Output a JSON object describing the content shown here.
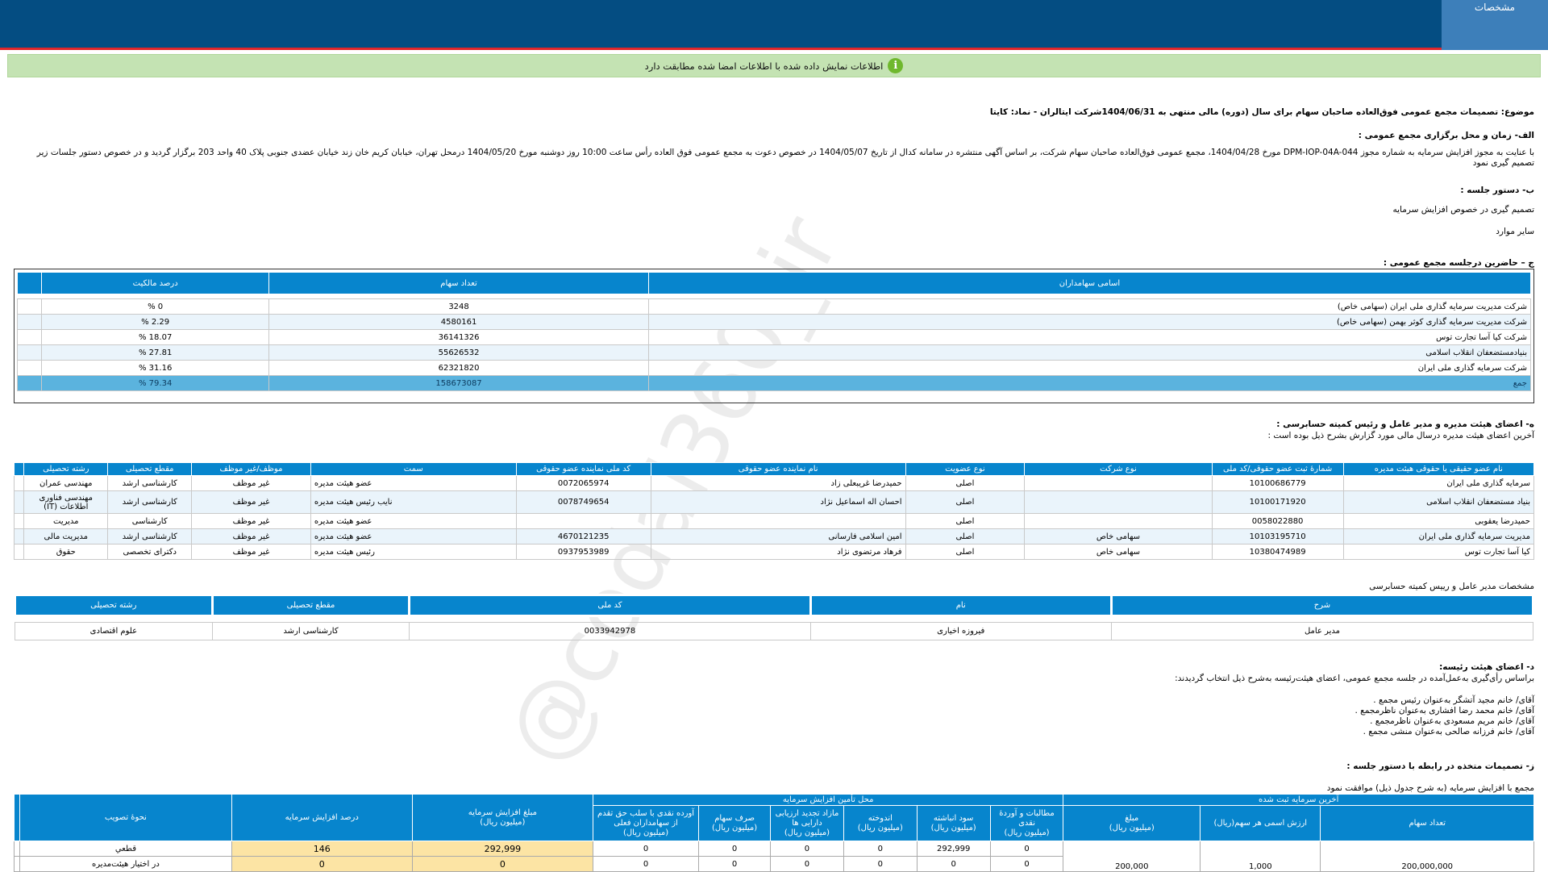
{
  "header": {
    "tab_label": "مشخصات"
  },
  "notice": {
    "text": "اطلاعات نمایش داده شده با اطلاعات امضا شده مطابقت دارد",
    "icon": "i"
  },
  "subject": "موضوع: تصمیمات مجمع عمومی فوق‌العاده صاحبان سهام برای سال (دوره) مالی منتهی به 1404/06/31شرکت ایتالران - نماد: کایتا",
  "section_a": {
    "title": "الف- زمان و محل برگزاری مجمع عمومی :",
    "text": "با عنایت به مجوز افزایش سرمایه به شماره مجوز DPM-IOP-04A-044 مورخ 1404/04/28، مجمع عمومی فوق‌العاده صاحبان سهام شرکت، بر اساس آگهی منتشره در سامانه کدال از تاریخ 1404/05/07 در خصوص دعوت به مجمع عمومی فوق العاده رأس ساعت 10:00 روز دوشنبه مورخ 1404/05/20 درمحل تهران، خیابان کریم خان زند خیابان عضدی جنوبی پلاک 40 واحد 203   برگزار گردید و در خصوص دستور جلسات زیر تصمیم گیری نمود"
  },
  "section_b": {
    "title": "ب- دستور جلسه :",
    "items": [
      "تصمیم گیری در خصوص افزایش سرمایه",
      "سایر موارد"
    ]
  },
  "section_c": {
    "title": "ج – حاضرین درجلسه مجمع عمومی :",
    "headers": [
      "اسامی سهامداران",
      "تعداد سهام",
      "درصد مالکیت"
    ],
    "rows": [
      [
        "شرکت مدیریت سرمایه گذاری ملی ایران (سهامی خاص)",
        "3248",
        "0 %"
      ],
      [
        "شرکت مدیریت سرمایه گذاری کوثر بهمن (سهامی خاص)",
        "4580161",
        "2.29 %"
      ],
      [
        "شرکت کیا آسا تجارت توس",
        "36141326",
        "18.07 %"
      ],
      [
        "بنیادمستضعفان انقلاب اسلامی",
        "55626532",
        "27.81 %"
      ],
      [
        "شرکت سرمایه گذاری ملی ایران",
        "62321820",
        "31.16 %"
      ]
    ],
    "total": [
      "جمع",
      "158673087",
      "79.34 %"
    ]
  },
  "section_d": {
    "title": "ه- اعضای هیئت مدیره و مدیر عامل و رئیس کمیته حسابرسی :",
    "subtitle": "آخرین اعضای هیئت مدیره درسال مالی مورد گزارش بشرح ذیل بوده است :",
    "headers": [
      "نام عضو حقیقی یا حقوقی هیئت مدیره",
      "شمارهٔ ثبت عضو حقوقی/کد ملی",
      "نوع شرکت",
      "نوع عضویت",
      "نام نماینده عضو حقوقی",
      "کد ملی نماینده عضو حقوقی",
      "سمت",
      "موظف/غیر موظف",
      "مقطع تحصیلی",
      "رشته تحصیلی"
    ],
    "rows": [
      [
        "سرمایه گذاری ملی ایران",
        "10100686779",
        "",
        "اصلی",
        "حمیدرضا غریبعلی زاد",
        "0072065974",
        "عضو هیئت مدیره",
        "غیر موظف",
        "کارشناسی ارشد",
        "مهندسی عمران"
      ],
      [
        "بنیاد مستضعفان انقلاب اسلامی",
        "10100171920",
        "",
        "اصلی",
        "احسان اله اسماعیل نژاد",
        "0078749654",
        "نایب رئیس هیئت مدیره",
        "غیر موظف",
        "کارشناسی ارشد",
        "مهندسی فناوری اطلاعات (IT)"
      ],
      [
        "حمیدرضا یعقوبی",
        "0058022880",
        "",
        "اصلی",
        "",
        "",
        "عضو هیئت مدیره",
        "غیر موظف",
        "کارشناسی",
        "مدیریت"
      ],
      [
        "مدیریت سرمایه گذاری ملی ایران",
        "10103195710",
        "سهامی خاص",
        "اصلی",
        "امین اسلامی فارسانی",
        "4670121235",
        "عضو هیئت مدیره",
        "غیر موظف",
        "کارشناسی ارشد",
        "مدیریت مالی"
      ],
      [
        "کیا آسا تجارت توس",
        "10380474989",
        "سهامی خاص",
        "اصلی",
        "فرهاد مرتضوی نژاد",
        "0937953989",
        "رئیس هیئت مدیره",
        "غیر موظف",
        "دکترای تخصصی",
        "حقوق"
      ]
    ]
  },
  "section_ceo": {
    "title": "مشخصات مدیر عامل و رییس کمیته حسابرسی",
    "headers": [
      "شرح",
      "نام",
      "کد ملی",
      "مقطع تحصیلی",
      "رشته تحصیلی"
    ],
    "row": [
      "مدیر عامل",
      "فیروزه اخیاری",
      "0033942978",
      "کارشناسی ارشد",
      "علوم اقتصادی"
    ]
  },
  "section_e": {
    "title": "د- اعضای هیئت رئیسه:",
    "subtitle": "براساس رأی‌گیری به‌عمل‌آمده در جلسه مجمع عمومی، اعضای هیئت‌رئیسه به‌شرح ذیل انتخاب گردیدند:",
    "items": [
      "آقای/ خانم  مجید آتشگر  به‌عنوان رئیس مجمع .",
      "آقای/ خانم  محمد رضا افشاری  به‌عنوان ناظرمجمع .",
      "آقای/ خانم  مریم مسعودی  به‌عنوان ناظرمجمع .",
      "آقای/ خانم  فرزانه صالحی  به‌عنوان منشی مجمع ."
    ]
  },
  "section_f": {
    "title": "ز- تصمیمات متخذه در رابطه با دستور جلسه :",
    "subtitle": "مجمع با افزایش سرمایه (به شرح جدول ذیل) موافقت نمود",
    "group_last": "آخرین سرمایه ثبت شده",
    "group_source": "محل تأمین  افزایش سرمایه",
    "h_shares": "تعداد سهام",
    "h_par": "ارزش اسمی هر سهم(ریال)",
    "h_amount": "مبلغ",
    "h_amount_unit": "(میلیون ریال)",
    "h_receivables": "مطالبات و آوردهٔ نقدی",
    "h_retained": "سود انباشته",
    "h_reserve": "اندوخته",
    "h_revaluation": "مازاد تجدید ارزیابی دارایی ها",
    "h_premium": "صرف سهام",
    "h_cash": "آورده نقدی با سلب حق تقدم از سهامداران فعلی",
    "h_increase_amount": "مبلغ  افزایش سرمایه",
    "h_increase_pct": "درصد افزایش سرمایه",
    "h_approval": "نحوهٔ تصویب",
    "unit": "(میلیون ریال)",
    "last_shares": "200,000,000",
    "last_par": "1,000",
    "last_amount": "200,000",
    "rows": [
      {
        "receivables": "0",
        "retained": "292,999",
        "reserve": "0",
        "revaluation": "0",
        "premium": "0",
        "cash": "0",
        "amount": "292,999",
        "pct": "146",
        "approval": "قطعي"
      },
      {
        "receivables": "0",
        "retained": "0",
        "reserve": "0",
        "revaluation": "0",
        "premium": "0",
        "cash": "0",
        "amount": "0",
        "pct": "0",
        "approval": "در اختيار هيئت‌مديره"
      }
    ]
  },
  "watermark": "@codal360_ir"
}
